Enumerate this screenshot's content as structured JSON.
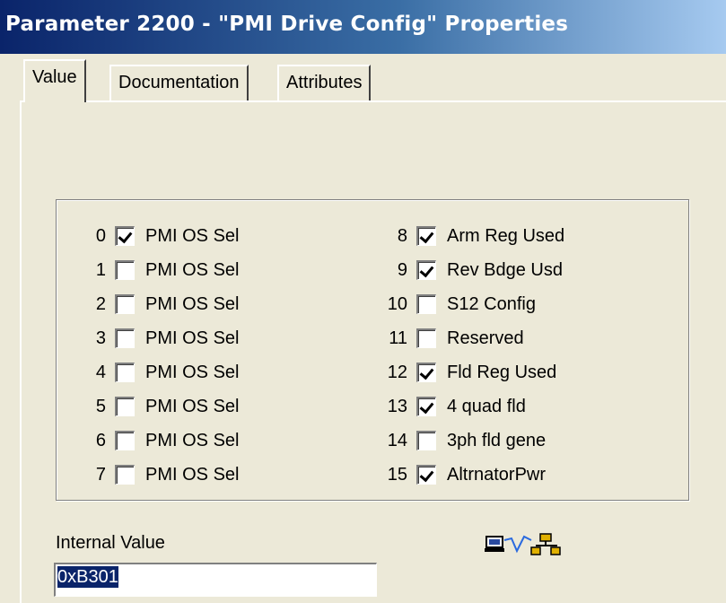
{
  "window": {
    "title": "Parameter 2200 - \"PMI Drive Config\" Properties"
  },
  "tabs": [
    {
      "label": "Value",
      "active": true
    },
    {
      "label": "Documentation",
      "active": false
    },
    {
      "label": "Attributes",
      "active": false
    }
  ],
  "bits": [
    {
      "num": "0",
      "label": "PMI OS Sel",
      "checked": true
    },
    {
      "num": "1",
      "label": "PMI OS Sel",
      "checked": false
    },
    {
      "num": "2",
      "label": "PMI OS Sel",
      "checked": false
    },
    {
      "num": "3",
      "label": "PMI OS Sel",
      "checked": false
    },
    {
      "num": "4",
      "label": "PMI OS Sel",
      "checked": false
    },
    {
      "num": "5",
      "label": "PMI OS Sel",
      "checked": false
    },
    {
      "num": "6",
      "label": "PMI OS Sel",
      "checked": false
    },
    {
      "num": "7",
      "label": "PMI OS Sel",
      "checked": false
    },
    {
      "num": "8",
      "label": "Arm Reg Used",
      "checked": true
    },
    {
      "num": "9",
      "label": "Rev Bdge Usd",
      "checked": true
    },
    {
      "num": "10",
      "label": "S12 Config",
      "checked": false
    },
    {
      "num": "11",
      "label": "Reserved",
      "checked": false
    },
    {
      "num": "12",
      "label": "Fld Reg Used",
      "checked": true
    },
    {
      "num": "13",
      "label": "4 quad fld",
      "checked": true
    },
    {
      "num": "14",
      "label": "3ph fld gene",
      "checked": false
    },
    {
      "num": "15",
      "label": "AltrnatorPwr",
      "checked": true
    }
  ],
  "internal_value": {
    "label": "Internal Value",
    "value": "0xB301"
  },
  "icons": {
    "network": "network-link-icon"
  },
  "colors": {
    "titlebar_start": "#0a246a",
    "titlebar_end": "#a6caf0",
    "selection": "#0a246a"
  }
}
